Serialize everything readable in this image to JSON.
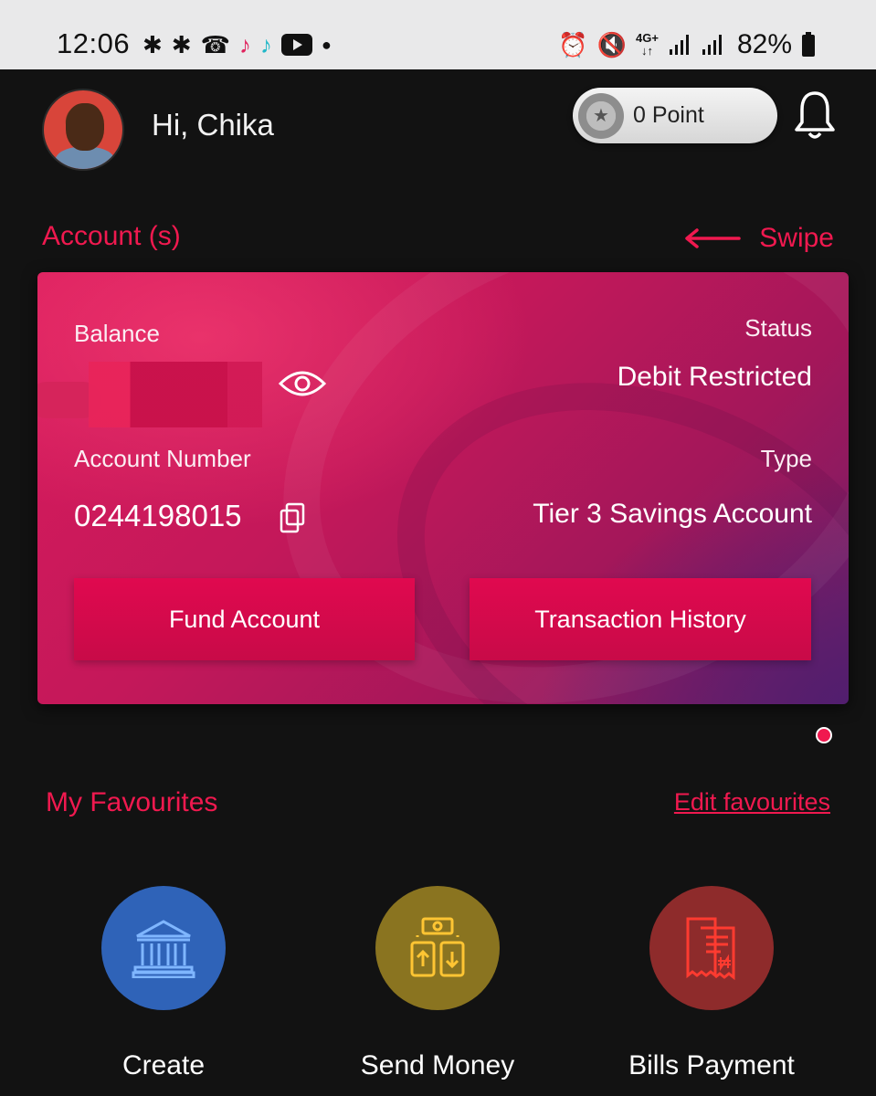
{
  "status_bar": {
    "time": "12:06",
    "left_icons": [
      "slack-icon",
      "slack-icon",
      "missed-call-icon",
      "tiktok-icon",
      "tiktok-icon",
      "youtube-icon",
      "dot-icon"
    ],
    "network": "4G+",
    "battery_percent": "82%"
  },
  "header": {
    "greeting": "Hi, Chika",
    "points_label": "0 Point"
  },
  "accounts": {
    "section_title": "Account (s)",
    "swipe_label": "Swipe",
    "card": {
      "balance_label": "Balance",
      "status_label": "Status",
      "status_value": "Debit Restricted",
      "account_number_label": "Account Number",
      "account_number": "0244198015",
      "type_label": "Type",
      "type_value": "Tier 3 Savings Account",
      "fund_button": "Fund Account",
      "history_button": "Transaction History"
    }
  },
  "favourites": {
    "section_title": "My Favourites",
    "edit_label": "Edit favourites",
    "items": [
      {
        "label": "Create",
        "icon": "bank-icon",
        "color": "#2f63b8"
      },
      {
        "label": "Send Money",
        "icon": "money-transfer-icon",
        "color": "#8a7420"
      },
      {
        "label": "Bills Payment",
        "icon": "receipt-naira-icon",
        "color": "#8e2b2b"
      }
    ]
  },
  "colors": {
    "accent": "#f0194f",
    "background": "#121212"
  }
}
